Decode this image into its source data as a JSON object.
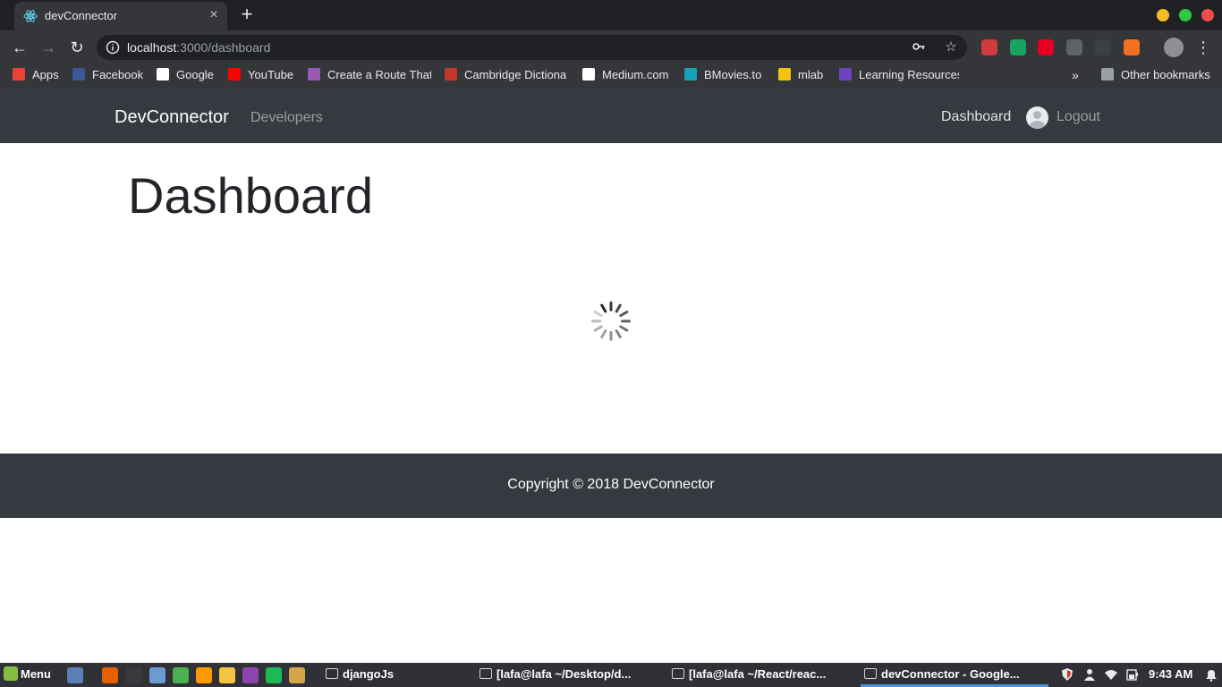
{
  "browser": {
    "tab": {
      "title": "devConnector",
      "close": "×",
      "new_tab": "+"
    },
    "window_colors": {
      "minimize": "#f6bf26",
      "maximize": "#2ec940",
      "close": "#f14c4c"
    },
    "toolbar": {
      "back": "←",
      "forward": "→",
      "reload": "↻",
      "url_host": "localhost",
      "url_path": ":3000/dashboard",
      "key_icon": "key-icon",
      "star": "☆",
      "menu": "⋮"
    },
    "extensions": [
      {
        "name": "extension-red-icon",
        "color": "#d03b3b"
      },
      {
        "name": "extension-green-icon",
        "color": "#1aa260"
      },
      {
        "name": "pinterest-icon",
        "color": "#e60023"
      },
      {
        "name": "check-icon",
        "color": "#5f6368"
      },
      {
        "name": "extension-dark-icon",
        "color": "#3c4043"
      },
      {
        "name": "extension-orange-icon",
        "color": "#f37021"
      }
    ],
    "bookmarks": [
      {
        "label": "Apps",
        "icon": "apps-icon",
        "color": "#ea4335"
      },
      {
        "label": "Facebook",
        "icon": "facebook-icon",
        "color": "#3b5998"
      },
      {
        "label": "Google",
        "icon": "google-icon",
        "color": "#ffffff"
      },
      {
        "label": "YouTube",
        "icon": "youtube-icon",
        "color": "#ff0000"
      },
      {
        "label": "Create a Route That",
        "icon": "cloud-icon",
        "color": "#9b59b6"
      },
      {
        "label": "Cambridge Dictiona",
        "icon": "cambridge-icon",
        "color": "#c0392b"
      },
      {
        "label": "Medium.com",
        "icon": "medium-icon",
        "color": "#ffffff"
      },
      {
        "label": "BMovies.to",
        "icon": "play-icon",
        "color": "#17a2b8"
      },
      {
        "label": "mlab",
        "icon": "mlab-icon",
        "color": "#f1c40f"
      },
      {
        "label": "Learning Resources",
        "icon": "learning-icon",
        "color": "#6f42c1"
      }
    ],
    "bookmarks_more": "»",
    "other_bookmarks": "Other bookmarks"
  },
  "app": {
    "brand": "DevConnector",
    "nav": {
      "developers": "Developers",
      "dashboard": "Dashboard",
      "logout": "Logout"
    },
    "page_title": "Dashboard",
    "footer": "Copyright © 2018 DevConnector",
    "colors": {
      "navbar_bg": "#343a40",
      "title": "#212529"
    }
  },
  "taskbar": {
    "menu": "Menu",
    "launchers": [
      {
        "name": "show-desktop-icon",
        "color": "#5a7fb5"
      },
      {
        "name": "firefox-icon",
        "color": "#e66000"
      },
      {
        "name": "terminal-icon",
        "color": "#3a3a3a"
      },
      {
        "name": "files-icon",
        "color": "#6c9bd2"
      },
      {
        "name": "chrome-icon",
        "color": "#4caf50"
      },
      {
        "name": "sublime-icon",
        "color": "#ff9800"
      },
      {
        "name": "folder-icon",
        "color": "#f4c542"
      },
      {
        "name": "video-icon",
        "color": "#8e44ad"
      },
      {
        "name": "spotify-icon",
        "color": "#1db954"
      },
      {
        "name": "image-viewer-icon",
        "color": "#d4a64a"
      }
    ],
    "windows": [
      {
        "title": "djangoJs",
        "icon": "folder-icon"
      },
      {
        "title": "[lafa@lafa ~/Desktop/d...",
        "icon": "terminal-icon"
      },
      {
        "title": "[lafa@lafa ~/React/reac...",
        "icon": "terminal-icon"
      },
      {
        "title": "devConnector - Google...",
        "icon": "chrome-icon"
      }
    ],
    "clock": "9:43 AM"
  }
}
